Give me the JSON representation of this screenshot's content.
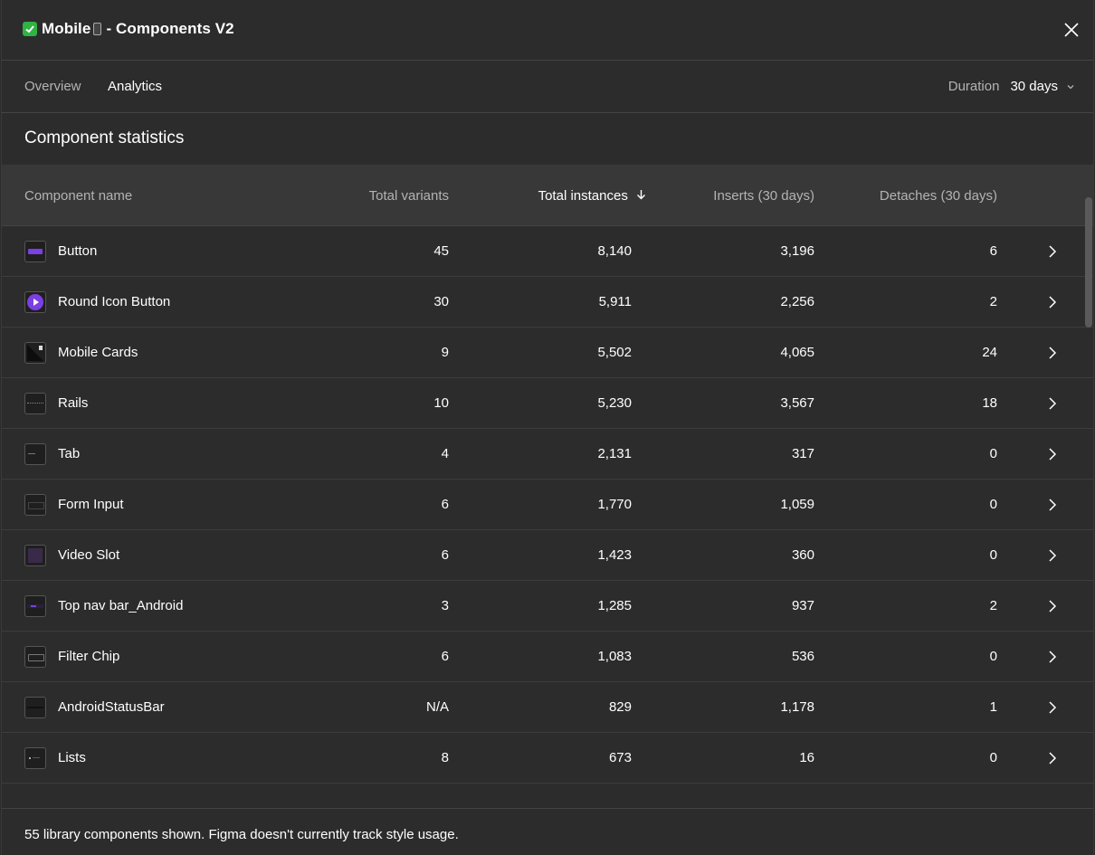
{
  "header": {
    "title_name": "Mobile",
    "title_rest": "- Components V2",
    "close_icon": "close-icon"
  },
  "tabs": [
    {
      "label": "Overview",
      "active": false
    },
    {
      "label": "Analytics",
      "active": true
    }
  ],
  "duration": {
    "label": "Duration",
    "value": "30 days"
  },
  "section_title": "Component statistics",
  "table": {
    "columns": {
      "name": "Component name",
      "variants": "Total variants",
      "instances": "Total instances",
      "inserts": "Inserts (30 days)",
      "detaches": "Detaches (30 days)"
    },
    "sorted_by": "instances",
    "rows": [
      {
        "name": "Button",
        "variants": "45",
        "instances": "8,140",
        "inserts": "3,196",
        "detaches": "6",
        "thumb": "button"
      },
      {
        "name": "Round Icon Button",
        "variants": "30",
        "instances": "5,911",
        "inserts": "2,256",
        "detaches": "2",
        "thumb": "round"
      },
      {
        "name": "Mobile Cards",
        "variants": "9",
        "instances": "5,502",
        "inserts": "4,065",
        "detaches": "24",
        "thumb": "cards"
      },
      {
        "name": "Rails",
        "variants": "10",
        "instances": "5,230",
        "inserts": "3,567",
        "detaches": "18",
        "thumb": "rails"
      },
      {
        "name": "Tab",
        "variants": "4",
        "instances": "2,131",
        "inserts": "317",
        "detaches": "0",
        "thumb": "tab"
      },
      {
        "name": "Form Input",
        "variants": "6",
        "instances": "1,770",
        "inserts": "1,059",
        "detaches": "0",
        "thumb": "form"
      },
      {
        "name": "Video Slot",
        "variants": "6",
        "instances": "1,423",
        "inserts": "360",
        "detaches": "0",
        "thumb": "video"
      },
      {
        "name": "Top nav bar_Android",
        "variants": "3",
        "instances": "1,285",
        "inserts": "937",
        "detaches": "2",
        "thumb": "nav"
      },
      {
        "name": "Filter Chip",
        "variants": "6",
        "instances": "1,083",
        "inserts": "536",
        "detaches": "0",
        "thumb": "chip"
      },
      {
        "name": "AndroidStatusBar",
        "variants": "N/A",
        "instances": "829",
        "inserts": "1,178",
        "detaches": "1",
        "thumb": "status"
      },
      {
        "name": "Lists",
        "variants": "8",
        "instances": "673",
        "inserts": "16",
        "detaches": "0",
        "thumb": "lists"
      }
    ]
  },
  "footer": {
    "text": "55 library components shown. Figma doesn't currently track style usage."
  },
  "colors": {
    "background": "#2c2c2c",
    "header_row": "#383838",
    "accent_purple": "#7b3fe4",
    "check_green": "#2fb344"
  }
}
